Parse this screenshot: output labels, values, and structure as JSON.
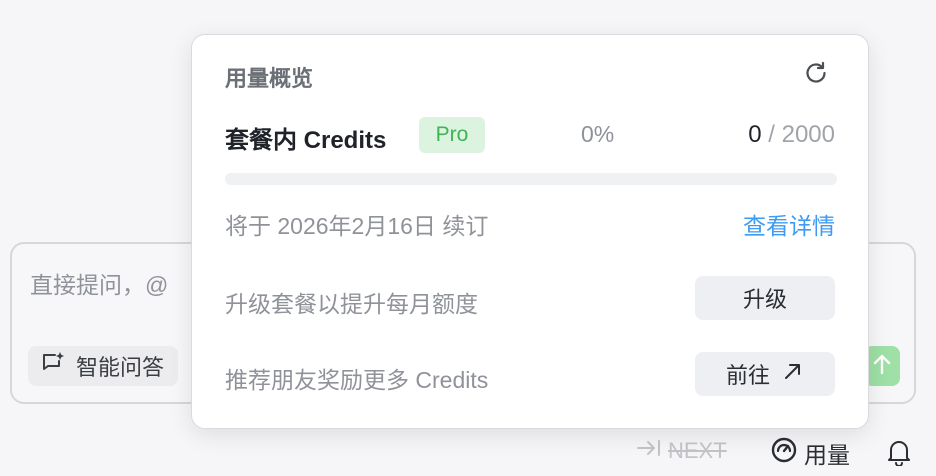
{
  "background": {
    "input_placeholder": "直接提问，@",
    "chip_label": "智能问答",
    "chip_icon": "sparkle-chat-icon",
    "send_icon": "arrow-up-icon"
  },
  "bottom_bar": {
    "next_label": "NEXT",
    "usage_label": "用量",
    "bell_icon": "bell-icon"
  },
  "popover": {
    "title": "用量概览",
    "refresh_icon": "refresh-icon",
    "plan": {
      "label": "套餐内 Credits",
      "badge": "Pro",
      "percent": "0%",
      "used": "0",
      "separator_total": " / 2000",
      "progress_fraction": 0
    },
    "renew_text": "将于 2026年2月16日 续订",
    "details_link": "查看详情",
    "upgrade_row": {
      "text": "升级套餐以提升每月额度",
      "button": "升级"
    },
    "referral_row": {
      "text": "推荐朋友奖励更多 Credits",
      "button": "前往",
      "button_icon": "arrow-up-right-icon"
    }
  },
  "colors": {
    "accent_green": "#3fb457",
    "link_blue": "#3e9bf2",
    "badge_bg": "#dcf3df"
  }
}
